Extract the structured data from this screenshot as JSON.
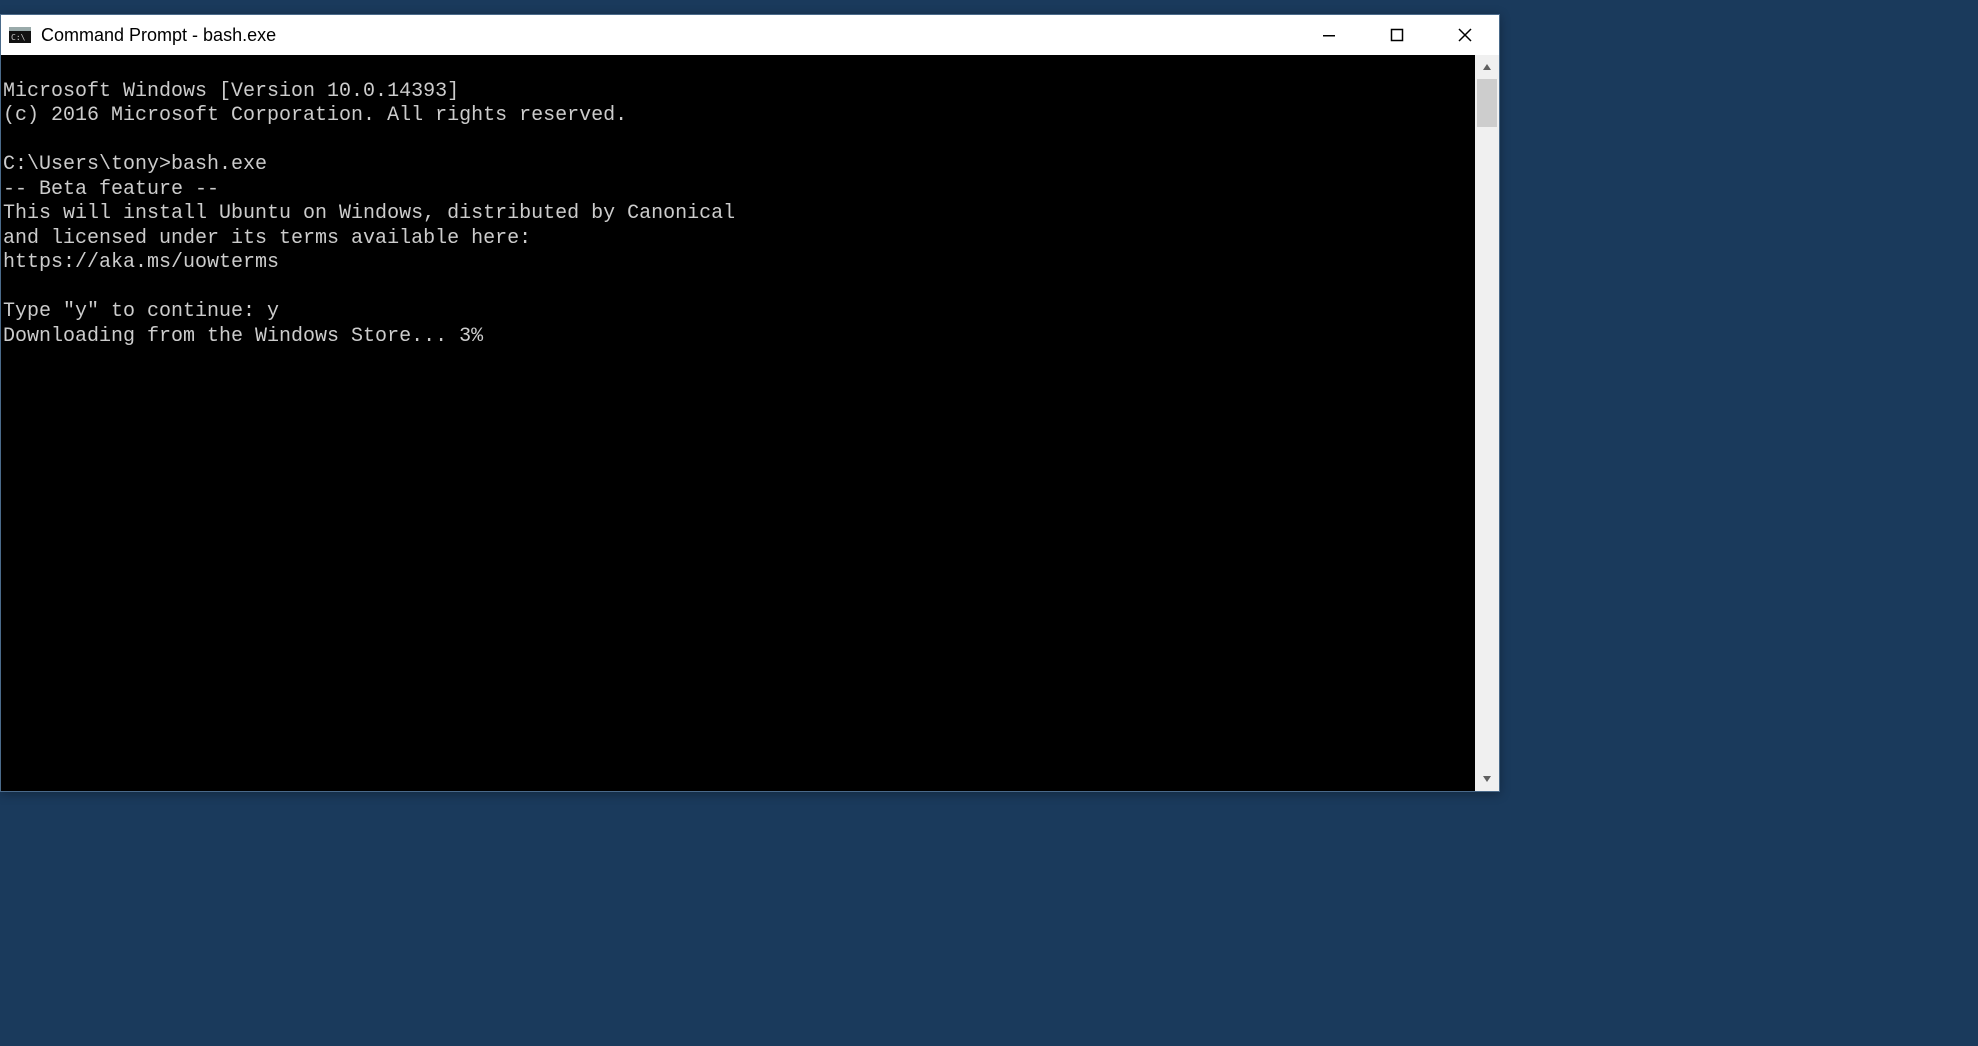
{
  "window": {
    "title": "Command Prompt - bash.exe"
  },
  "terminal": {
    "lines": [
      "Microsoft Windows [Version 10.0.14393]",
      "(c) 2016 Microsoft Corporation. All rights reserved.",
      "",
      "C:\\Users\\tony>bash.exe",
      "-- Beta feature --",
      "This will install Ubuntu on Windows, distributed by Canonical",
      "and licensed under its terms available here:",
      "https://aka.ms/uowterms",
      "",
      "Type \"y\" to continue: y",
      "Downloading from the Windows Store... 3%"
    ]
  }
}
